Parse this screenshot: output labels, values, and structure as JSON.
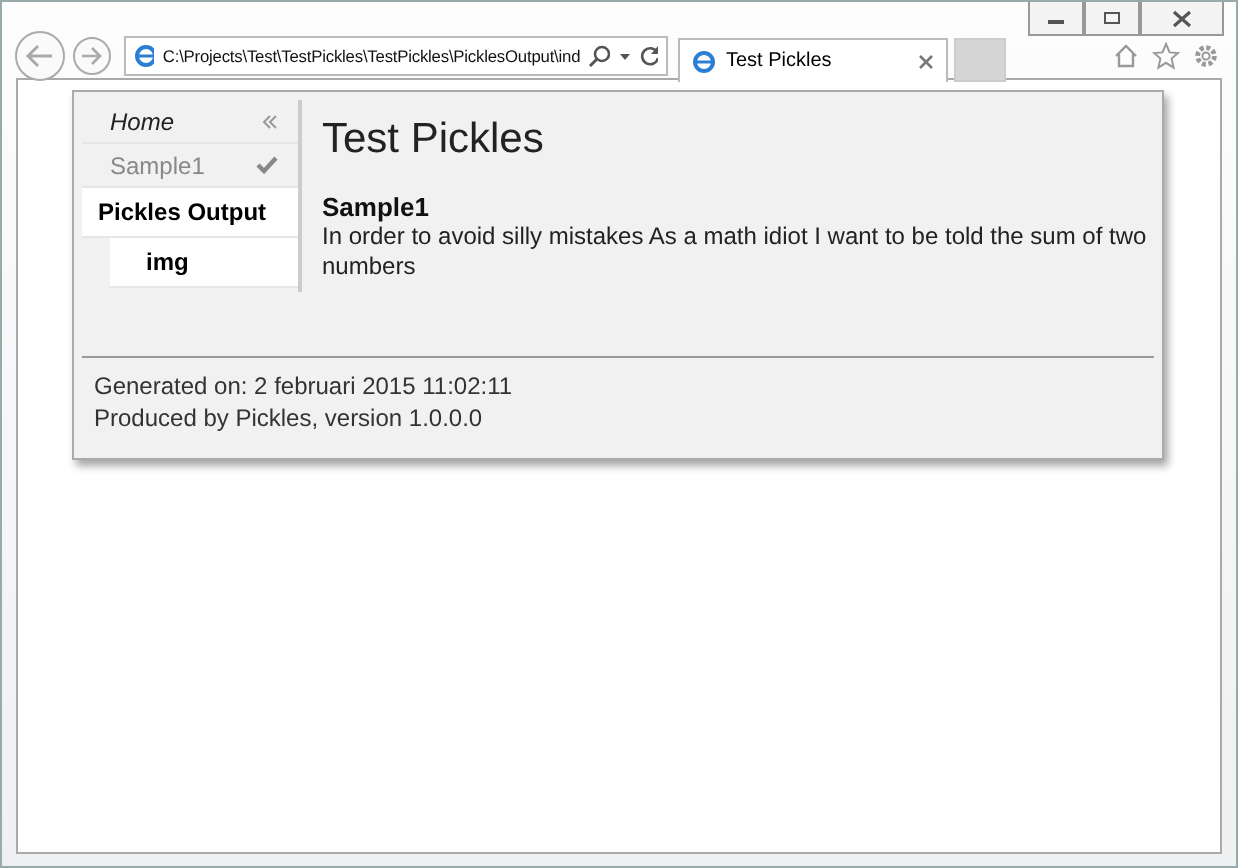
{
  "browser": {
    "address": "C:\\Projects\\Test\\TestPickles\\TestPickles\\PicklesOutput\\ind",
    "tabs": [
      {
        "label": "Test Pickles",
        "selected": true
      }
    ]
  },
  "nav": {
    "items": [
      {
        "kind": "link",
        "label": "Home"
      },
      {
        "kind": "feature",
        "label": "Sample1",
        "passed": true
      },
      {
        "kind": "folder",
        "label": "Pickles Output",
        "children": [
          {
            "label": "img"
          }
        ]
      }
    ]
  },
  "content": {
    "title": "Test Pickles",
    "feature": {
      "name": "Sample1",
      "description": "In order to avoid silly mistakes As a math idiot I want to be told the sum of two numbers"
    }
  },
  "footer": {
    "generated": "Generated on: 2 februari 2015 11:02:11",
    "produced": "Produced by Pickles, version 1.0.0.0"
  }
}
